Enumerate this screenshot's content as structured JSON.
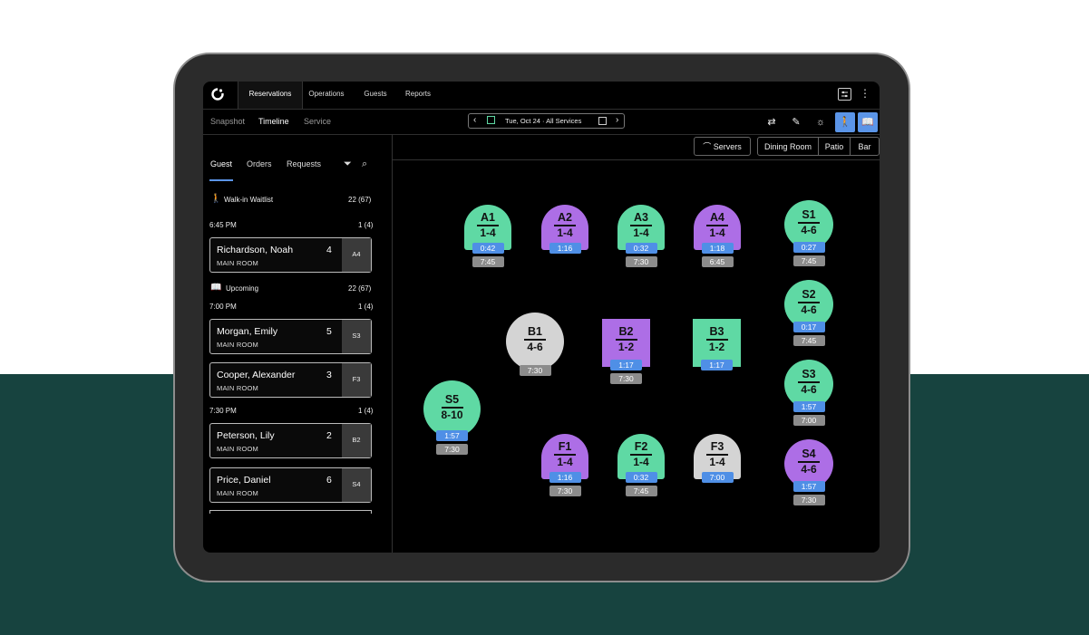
{
  "nav": {
    "tabs": [
      "Reservations",
      "Operations",
      "Guests",
      "Reports"
    ],
    "subtabs": [
      "Snapshot",
      "Timeline",
      "Service"
    ],
    "date_label": "Tue, Oct 24 · All Services"
  },
  "left": {
    "tabs": [
      "Guest",
      "Orders",
      "Requests"
    ],
    "walkin": {
      "label": "Walk-in Waitlist",
      "count": "22 (67)"
    },
    "upcoming": {
      "label": "Upcoming",
      "count": "22 (67)"
    },
    "times": [
      {
        "time": "6:45 PM",
        "count": "1 (4)"
      },
      {
        "time": "7:00 PM",
        "count": "1 (4)"
      },
      {
        "time": "7:30 PM",
        "count": "1 (4)"
      }
    ],
    "reservations": [
      {
        "name": "Richardson, Noah",
        "room": "MAIN ROOM",
        "party": "4",
        "table": "A4"
      },
      {
        "name": "Morgan, Emily",
        "room": "MAIN ROOM",
        "party": "5",
        "table": "S3"
      },
      {
        "name": "Cooper, Alexander",
        "room": "MAIN ROOM",
        "party": "3",
        "table": "F3"
      },
      {
        "name": "Peterson, Lily",
        "room": "MAIN ROOM",
        "party": "2",
        "table": "B2"
      },
      {
        "name": "Price, Daniel",
        "room": "MAIN ROOM",
        "party": "6",
        "table": "S4"
      }
    ]
  },
  "floor": {
    "servers_label": "Servers",
    "rooms": [
      "Dining Room",
      "Patio",
      "Bar"
    ],
    "tables": {
      "A1": {
        "name": "A1",
        "cap": "1-4",
        "t1": "0:42",
        "t2": "7:45",
        "color": "#5fd9a4"
      },
      "A2": {
        "name": "A2",
        "cap": "1-4",
        "t1": "1:16",
        "t2": "",
        "color": "#ad6ee6"
      },
      "A3": {
        "name": "A3",
        "cap": "1-4",
        "t1": "0:32",
        "t2": "7:30",
        "color": "#5fd9a4"
      },
      "A4": {
        "name": "A4",
        "cap": "1-4",
        "t1": "1:18",
        "t2": "6:45",
        "color": "#ad6ee6"
      },
      "S1": {
        "name": "S1",
        "cap": "4-6",
        "t1": "0:27",
        "t2": "7:45",
        "color": "#5fd9a4"
      },
      "S2": {
        "name": "S2",
        "cap": "4-6",
        "t1": "0:17",
        "t2": "7:45",
        "color": "#5fd9a4"
      },
      "S3": {
        "name": "S3",
        "cap": "4-6",
        "t1": "1:57",
        "t2": "7:00",
        "color": "#5fd9a4"
      },
      "S4": {
        "name": "S4",
        "cap": "4-6",
        "t1": "1:57",
        "t2": "7:30",
        "color": "#ad6ee6"
      },
      "S5": {
        "name": "S5",
        "cap": "8-10",
        "t1": "1:57",
        "t2": "7:30",
        "color": "#5fd9a4"
      },
      "B1": {
        "name": "B1",
        "cap": "4-6",
        "t1": "",
        "t2": "7:30",
        "color": "#d4d4d4"
      },
      "B2": {
        "name": "B2",
        "cap": "1-2",
        "t1": "1:17",
        "t2": "7:30",
        "color": "#ad6ee6"
      },
      "B3": {
        "name": "B3",
        "cap": "1-2",
        "t1": "1:17",
        "t2": "",
        "color": "#5fd9a4"
      },
      "F1": {
        "name": "F1",
        "cap": "1-4",
        "t1": "1:16",
        "t2": "7:30",
        "color": "#ad6ee6"
      },
      "F2": {
        "name": "F2",
        "cap": "1-4",
        "t1": "0:32",
        "t2": "7:45",
        "color": "#5fd9a4"
      },
      "F3": {
        "name": "F3",
        "cap": "1-4",
        "t1": "7:00",
        "t2": "",
        "color": "#d4d4d4"
      }
    }
  },
  "colors": {
    "accent": "#5b95e8",
    "background_bottom": "#17433f",
    "green": "#5fd9a4",
    "purple": "#ad6ee6",
    "gray": "#d4d4d4"
  }
}
